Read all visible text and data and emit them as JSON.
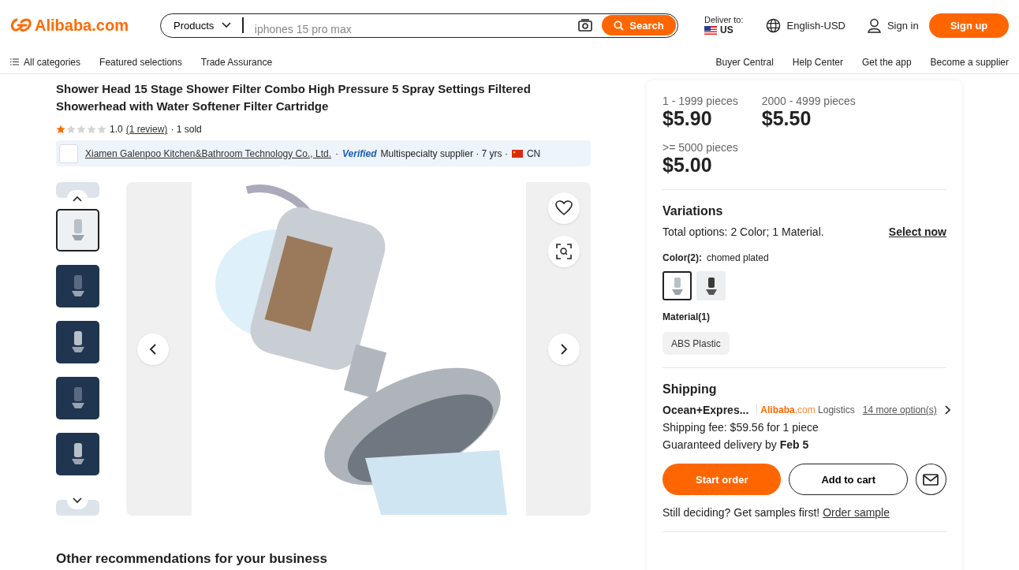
{
  "header": {
    "logo": "Alibaba.com",
    "search": {
      "category": "Products",
      "placeholder": "iphones 15 pro max",
      "button": "Search"
    },
    "deliver": {
      "label": "Deliver to:",
      "country": "US"
    },
    "language": "English-USD",
    "sign_in": "Sign in",
    "sign_up": "Sign up"
  },
  "nav": {
    "left": [
      "All categories",
      "Featured selections",
      "Trade Assurance"
    ],
    "right": [
      "Buyer Central",
      "Help Center",
      "Get the app",
      "Become a supplier"
    ]
  },
  "product": {
    "title": "Shower Head 15 Stage Shower Filter Combo High Pressure 5 Spray Settings Filtered Showerhead with Water Softener Filter Cartridge",
    "stars": 1,
    "rating": "1.0",
    "reviews": "(1 review)",
    "sold": "· 1 sold",
    "supplier": {
      "name": "Xiamen Galenpoo Kitchen&Bathroom Technology Co., Ltd.",
      "sep": "·",
      "verified": "Verified",
      "details": "Multispecialty supplier · 7 yrs ·",
      "country": "CN"
    }
  },
  "gallery": {
    "thumbnails": [
      {
        "selected": true
      },
      {
        "selected": false
      },
      {
        "selected": false
      },
      {
        "selected": false
      },
      {
        "selected": false
      }
    ]
  },
  "pricing": {
    "tiers": [
      {
        "range": "1 - 1999 pieces",
        "price": "$5.90"
      },
      {
        "range": "2000 - 4999 pieces",
        "price": "$5.50"
      },
      {
        "range": ">= 5000 pieces",
        "price": "$5.00"
      }
    ]
  },
  "variations": {
    "title": "Variations",
    "summary": "Total options: 2 Color; 1 Material.",
    "select": "Select now",
    "color_label": "Color(2):",
    "color_value": "chomed plated",
    "swatches": [
      {
        "selected": true
      },
      {
        "selected": false
      }
    ],
    "material_label": "Material(1)",
    "materials": [
      {
        "label": "ABS Plastic",
        "selected": false
      }
    ]
  },
  "shipping": {
    "title": "Shipping",
    "method": "Ocean+Expres...",
    "brand": "Alibaba",
    "domain": ".com",
    "logistics": "Logistics",
    "more": "14 more option(s)",
    "fee": "Shipping fee: $59.56 for 1 piece",
    "delivery": "Guaranteed delivery by **Feb 5**"
  },
  "actions": {
    "start": "Start order",
    "cart": "Add to cart"
  },
  "samples": {
    "text": "Still deciding? Get samples first!",
    "link": "Order sample"
  },
  "recommendations": {
    "title": "Other recommendations for your business"
  }
}
